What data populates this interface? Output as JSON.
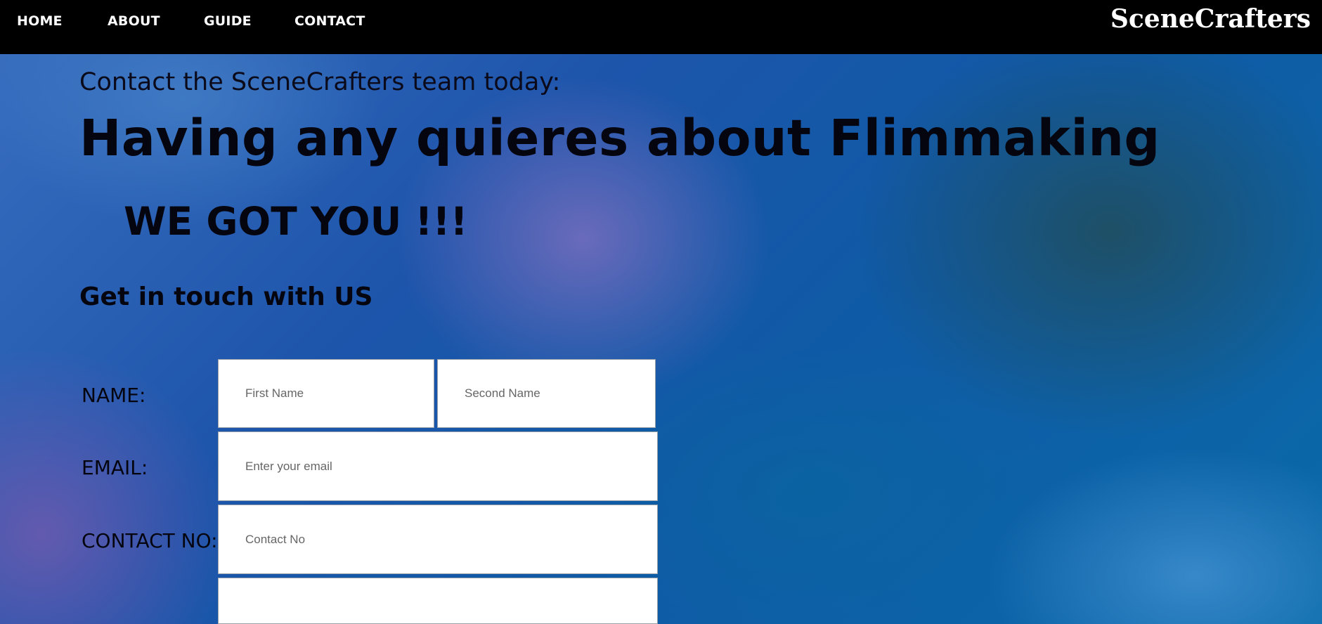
{
  "nav": {
    "items": [
      "HOME",
      "ABOUT",
      "GUIDE",
      "CONTACT"
    ],
    "brand": "SceneCrafters"
  },
  "hero": {
    "intro": "Contact the SceneCrafters team today:",
    "headline": "Having any quieres about Flimmaking",
    "subheadline": "WE GOT YOU !!!",
    "touch": "Get in touch with US"
  },
  "form": {
    "name_label": "NAME:",
    "email_label": "EMAIL:",
    "contact_label": "CONTACT NO:",
    "first_name_placeholder": "First Name",
    "second_name_placeholder": "Second Name",
    "email_placeholder": "Enter your email",
    "contact_placeholder": "Contact No",
    "message_value": ""
  }
}
